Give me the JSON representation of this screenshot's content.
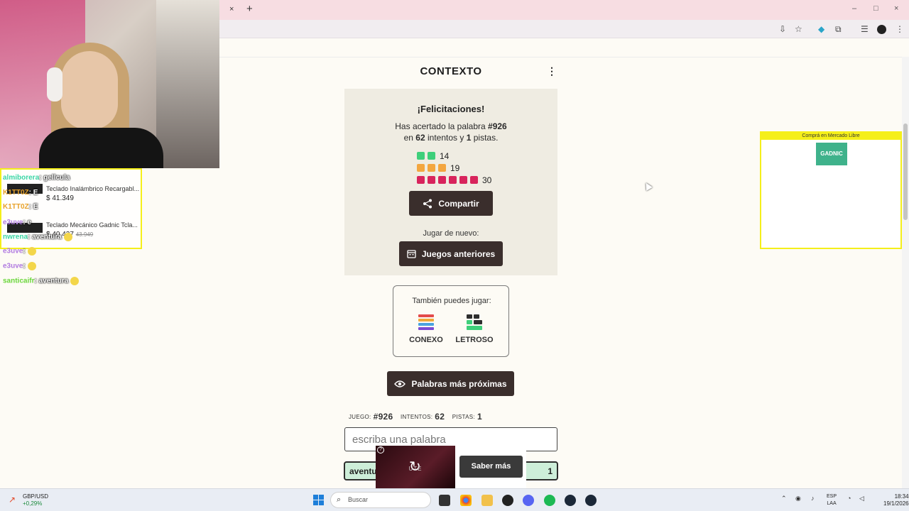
{
  "browser": {
    "close_tab_glyph": "×",
    "new_tab_glyph": "+",
    "window_controls": [
      "–",
      "□",
      "×"
    ]
  },
  "app": {
    "title": "CONTEXTO",
    "menu_glyph": "⋮"
  },
  "result": {
    "heading": "¡Felicitaciones!",
    "line1_prefix": "Has acertado la palabra",
    "game_number": "#926",
    "line2_prefix": "en",
    "attempts": "62",
    "attempts_label": "intentos y",
    "hints": "1",
    "hints_label": "pistas.",
    "distribution": [
      {
        "color": "#3ecf7a",
        "squares": 2,
        "count": "14"
      },
      {
        "color": "#f3a640",
        "squares": 3,
        "count": "19"
      },
      {
        "color": "#d8245c",
        "squares": 6,
        "count": "30"
      }
    ],
    "share_label": "Compartir",
    "play_again_label": "Jugar de nuevo:",
    "previous_games_label": "Juegos anteriores"
  },
  "other_games": {
    "title": "También puedes jugar:",
    "games": [
      {
        "name": "CONEXO",
        "icon": "conexo-icon"
      },
      {
        "name": "LETROSO",
        "icon": "letroso-icon"
      }
    ]
  },
  "closest_words_label": "Palabras más próximas",
  "stats": {
    "game_label": "JUEGO:",
    "game_value": "#926",
    "attempts_label": "INTENTOS:",
    "attempts_value": "62",
    "hints_label": "PISTAS:",
    "hints_value": "1"
  },
  "input": {
    "placeholder": "escriba una palabra"
  },
  "guess": {
    "word": "aventu",
    "rank": "1"
  },
  "ad": {
    "learn_more": "Saber más",
    "video_text": "UTE"
  },
  "right_ad": {
    "header": "Comprá en Mercado Libre",
    "brand": "GADNIC"
  },
  "stream_overlay": {
    "products": [
      {
        "title": "Teclado Inalámbrico Recargabl...",
        "price": "$ 41.349"
      },
      {
        "title": "Teclado Mecánico Gadnic Tcla...",
        "price": "$ 40.437",
        "old_price": "43.949"
      }
    ],
    "chat": [
      {
        "user": "almiborera",
        "color": "#3ad6a5",
        "msg": ": gellcula"
      },
      {
        "user": "K1TT0Z",
        "color": "#e8a22a",
        "msg": ": E"
      },
      {
        "user": "K1TT0Z",
        "color": "#e8a22a",
        "msg": ": E"
      },
      {
        "user": "e3uve",
        "color": "#b07ae0",
        "msg": ": e"
      },
      {
        "user": "nwrena",
        "color": "#3ad6a5",
        "msg": ": aventura"
      },
      {
        "user": "e3uve",
        "color": "#b07ae0",
        "msg": ":"
      },
      {
        "user": "e3uve",
        "color": "#b07ae0",
        "msg": ":"
      },
      {
        "user": "santicaifr",
        "color": "#6ad63a",
        "msg": ": aventura"
      }
    ]
  },
  "taskbar": {
    "ticker": "GBP/USD",
    "ticker_change": "+0,29%",
    "search_placeholder": "Buscar",
    "lang_line1": "ESP",
    "lang_line2": "LAA",
    "time": "18:34",
    "date": "19/1/2026"
  }
}
